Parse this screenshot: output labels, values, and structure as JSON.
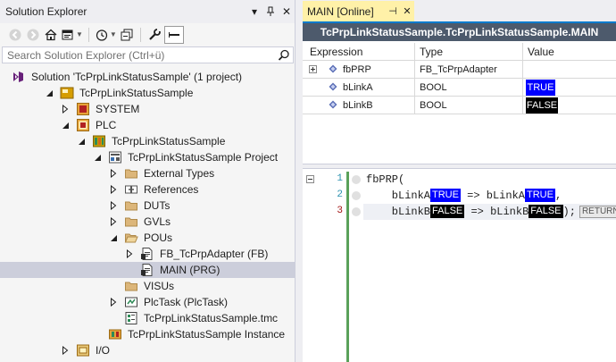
{
  "solution_explorer": {
    "title": "Solution Explorer",
    "search_placeholder": "Search Solution Explorer (Ctrl+ü)",
    "tree": [
      {
        "label": "Solution 'TcPrpLinkStatusSample' (1 project)",
        "icon": "solution-icon",
        "expand": "none"
      },
      {
        "label": "TcPrpLinkStatusSample",
        "icon": "twincat-project-icon",
        "expand": "expanded"
      },
      {
        "label": "SYSTEM",
        "icon": "system-icon",
        "expand": "collapsed"
      },
      {
        "label": "PLC",
        "icon": "plc-icon",
        "expand": "expanded"
      },
      {
        "label": "TcPrpLinkStatusSample",
        "icon": "plc-project-icon",
        "expand": "expanded"
      },
      {
        "label": "TcPrpLinkStatusSample Project",
        "icon": "plc-subproject-icon",
        "expand": "expanded"
      },
      {
        "label": "External Types",
        "icon": "folder-icon",
        "expand": "collapsed"
      },
      {
        "label": "References",
        "icon": "references-icon",
        "expand": "collapsed"
      },
      {
        "label": "DUTs",
        "icon": "folder-icon",
        "expand": "collapsed"
      },
      {
        "label": "GVLs",
        "icon": "folder-icon",
        "expand": "collapsed"
      },
      {
        "label": "POUs",
        "icon": "folder-open-icon",
        "expand": "expanded"
      },
      {
        "label": "FB_TcPrpAdapter (FB)",
        "icon": "pou-icon",
        "expand": "collapsed"
      },
      {
        "label": "MAIN (PRG)",
        "icon": "pou-icon",
        "expand": "none",
        "selected": true
      },
      {
        "label": "VISUs",
        "icon": "folder-icon",
        "expand": "none"
      },
      {
        "label": "PlcTask (PlcTask)",
        "icon": "task-icon",
        "expand": "collapsed"
      },
      {
        "label": "TcPrpLinkStatusSample.tmc",
        "icon": "tmc-icon",
        "expand": "none"
      },
      {
        "label": "TcPrpLinkStatusSample Instance",
        "icon": "instance-icon",
        "expand": "none"
      },
      {
        "label": "I/O",
        "icon": "io-icon",
        "expand": "collapsed"
      }
    ]
  },
  "main_window": {
    "tab_label": "MAIN [Online]",
    "header": "TcPrpLinkStatusSample.TcPrpLinkStatusSample.MAIN",
    "columns": {
      "expression": "Expression",
      "type": "Type",
      "value": "Value"
    },
    "variables": [
      {
        "name": "fbPRP",
        "type": "FB_TcPrpAdapter",
        "value": ""
      },
      {
        "name": "bLinkA",
        "type": "BOOL",
        "value": "TRUE"
      },
      {
        "name": "bLinkB",
        "type": "BOOL",
        "value": "FALSE"
      }
    ],
    "code": {
      "line_numbers": [
        "1",
        "2",
        "3"
      ],
      "line1": "fbPRP(",
      "line2_a": "    bLinkA",
      "line2_inl1": "TRUE",
      "line2_b": " => bLinkA",
      "line2_inl2": "TRUE",
      "line2_c": ",",
      "line3_a": "    bLinkB",
      "line3_inl1": "FALSE",
      "line3_b": " => bLinkB",
      "line3_inl2": "FALSE",
      "line3_c": ");",
      "return_label": "RETURN"
    }
  },
  "colors": {
    "true_bg": "#0000ff",
    "false_bg": "#000000",
    "tab_active": "#fff1a8",
    "header_bar": "#4d5a6c",
    "selection": "#cccedb",
    "accent": "#007acc"
  }
}
